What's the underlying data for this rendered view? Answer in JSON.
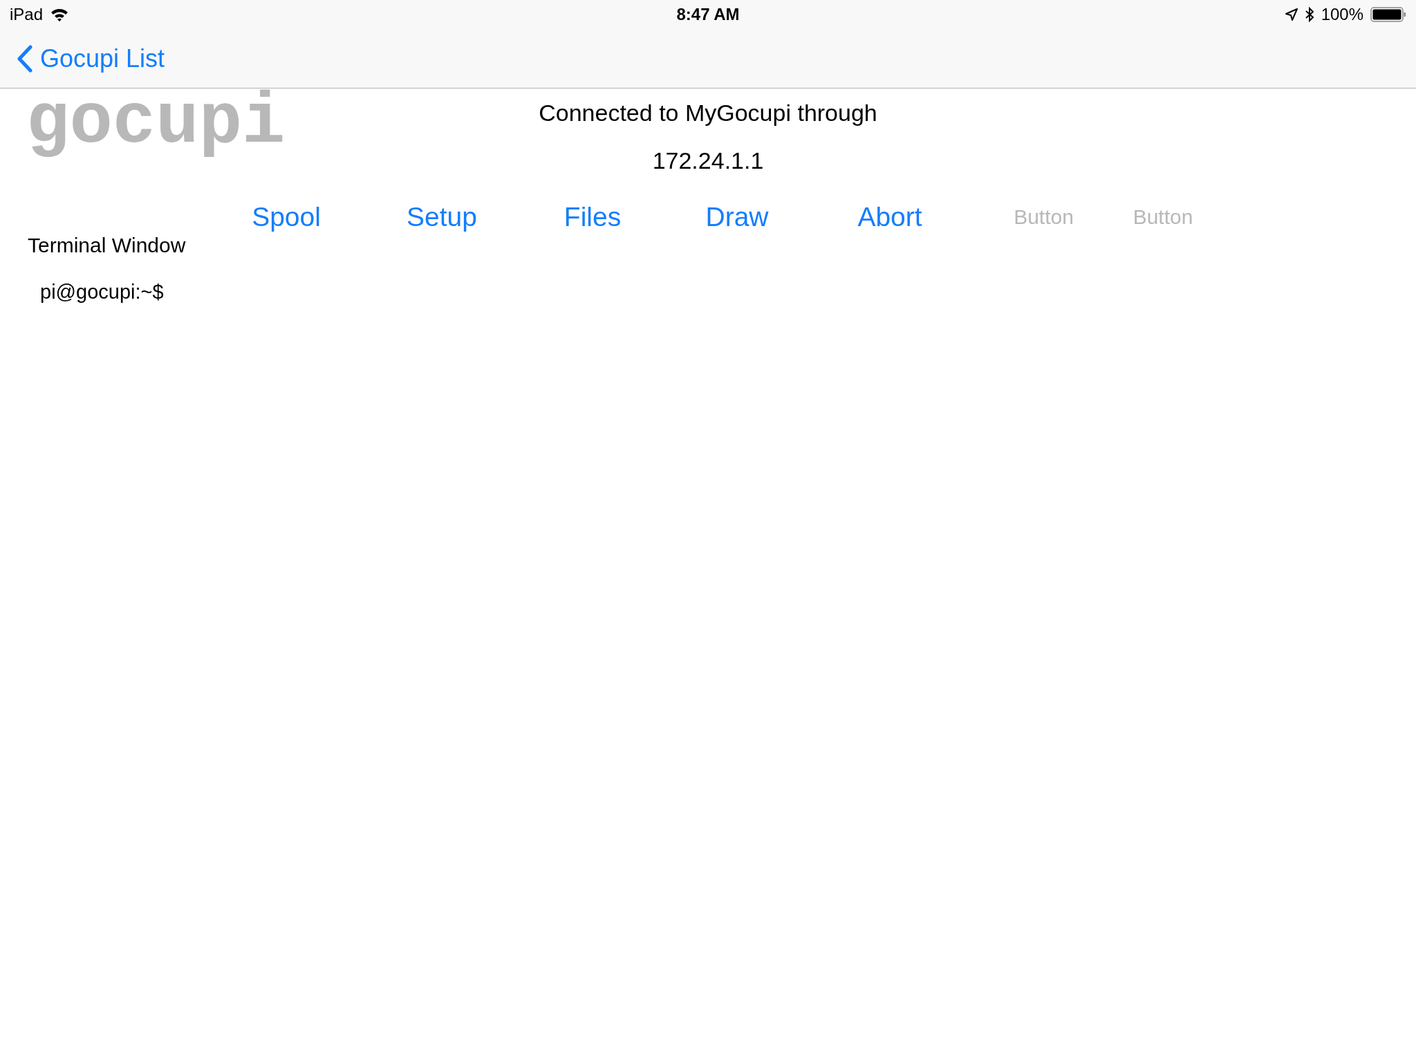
{
  "status_bar": {
    "device": "iPad",
    "time": "8:47 AM",
    "battery": "100%"
  },
  "nav": {
    "back": "Gocupi List"
  },
  "logo": "gocupi",
  "connection": {
    "message": "Connected to MyGocupi through",
    "address": "172.24.1.1"
  },
  "buttons": [
    {
      "label": "Spool",
      "disabled": false
    },
    {
      "label": "Setup",
      "disabled": false
    },
    {
      "label": "Files",
      "disabled": false
    },
    {
      "label": "Draw",
      "disabled": false
    },
    {
      "label": "Abort",
      "disabled": false
    },
    {
      "label": "Button",
      "disabled": true
    },
    {
      "label": "Button",
      "disabled": true
    }
  ],
  "terminal": {
    "title": "Terminal Window",
    "prompt": "pi@gocupi:~$"
  }
}
